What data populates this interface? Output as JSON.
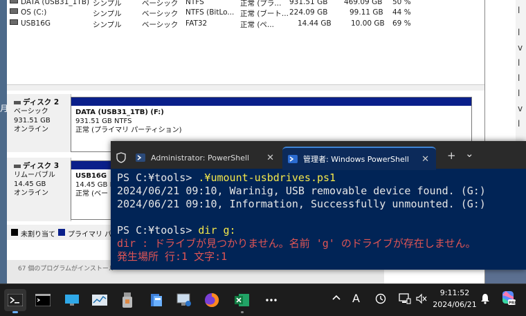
{
  "desktop_left_text": "月",
  "desktop_right_text": [
    "l",
    "l",
    "v",
    "l",
    "l",
    "l",
    "v",
    "l"
  ],
  "volumes": [
    {
      "name": "DATA (USB31_1TB)",
      "layout": "シンプル",
      "type": "ベーシック",
      "fs": "NTFS",
      "status": "正常 (プラ...",
      "capacity": "931.51 GB",
      "free": "469.09 GB",
      "pct": "50 %"
    },
    {
      "name": "OS (C:)",
      "layout": "シンプル",
      "type": "ベーシック",
      "fs": "NTFS (BitLo...",
      "status": "正常 (ブート...",
      "capacity": "224.09 GB",
      "free": "99.11 GB",
      "pct": "44 %"
    },
    {
      "name": "USB16G",
      "layout": "シンプル",
      "type": "ベーシック",
      "fs": "FAT32",
      "status": "正常 (ペ...",
      "capacity": "14.44 GB",
      "free": "10.00 GB",
      "pct": "69 %"
    }
  ],
  "disks": [
    {
      "name": "ディスク 2",
      "type": "ベーシック",
      "size": "931.51 GB",
      "state": "オンライン",
      "partition": {
        "title": "DATA (USB31_1TB) (F:)",
        "size": "931.51 GB NTFS",
        "status": "正常 (プライマリ パーティション)"
      }
    },
    {
      "name": "ディスク 3",
      "type": "リムーバブル",
      "size": "14.45 GB",
      "state": "オンライン",
      "partition": {
        "title": "USB16G",
        "size": "14.45 GB FA",
        "status": "正常 (ベー"
      }
    }
  ],
  "legend": {
    "unallocated": "未割り当て",
    "primary": "プライマリ パー"
  },
  "status_bar_text": "67 個のプログラムがインストール",
  "terminal": {
    "tab_inactive": "Administrator: PowerShell",
    "tab_active": "管理者: Windows PowerShell",
    "new_tab": "+",
    "dropdown": "⌄",
    "lines": [
      {
        "prompt": "PS C:¥tools> ",
        "command": ".¥umount-usbdrives.ps1"
      },
      {
        "text": "2024/06/21 09:10, Warinig, USB removable device found. (G:)"
      },
      {
        "text": "2024/06/21 09:10, Information, Successfully unmounted. (G:)"
      },
      {
        "text": ""
      },
      {
        "prompt": "PS C:¥tools> ",
        "command": "dir g:"
      },
      {
        "error": "dir : ドライブが見つかりません。名前 'g' のドライブが存在しません。"
      },
      {
        "error": "発生場所 行:1 文字:1"
      }
    ]
  },
  "taskbar": {
    "tray_ime": "A",
    "time": "9:11:52",
    "date": "2024/06/21"
  }
}
